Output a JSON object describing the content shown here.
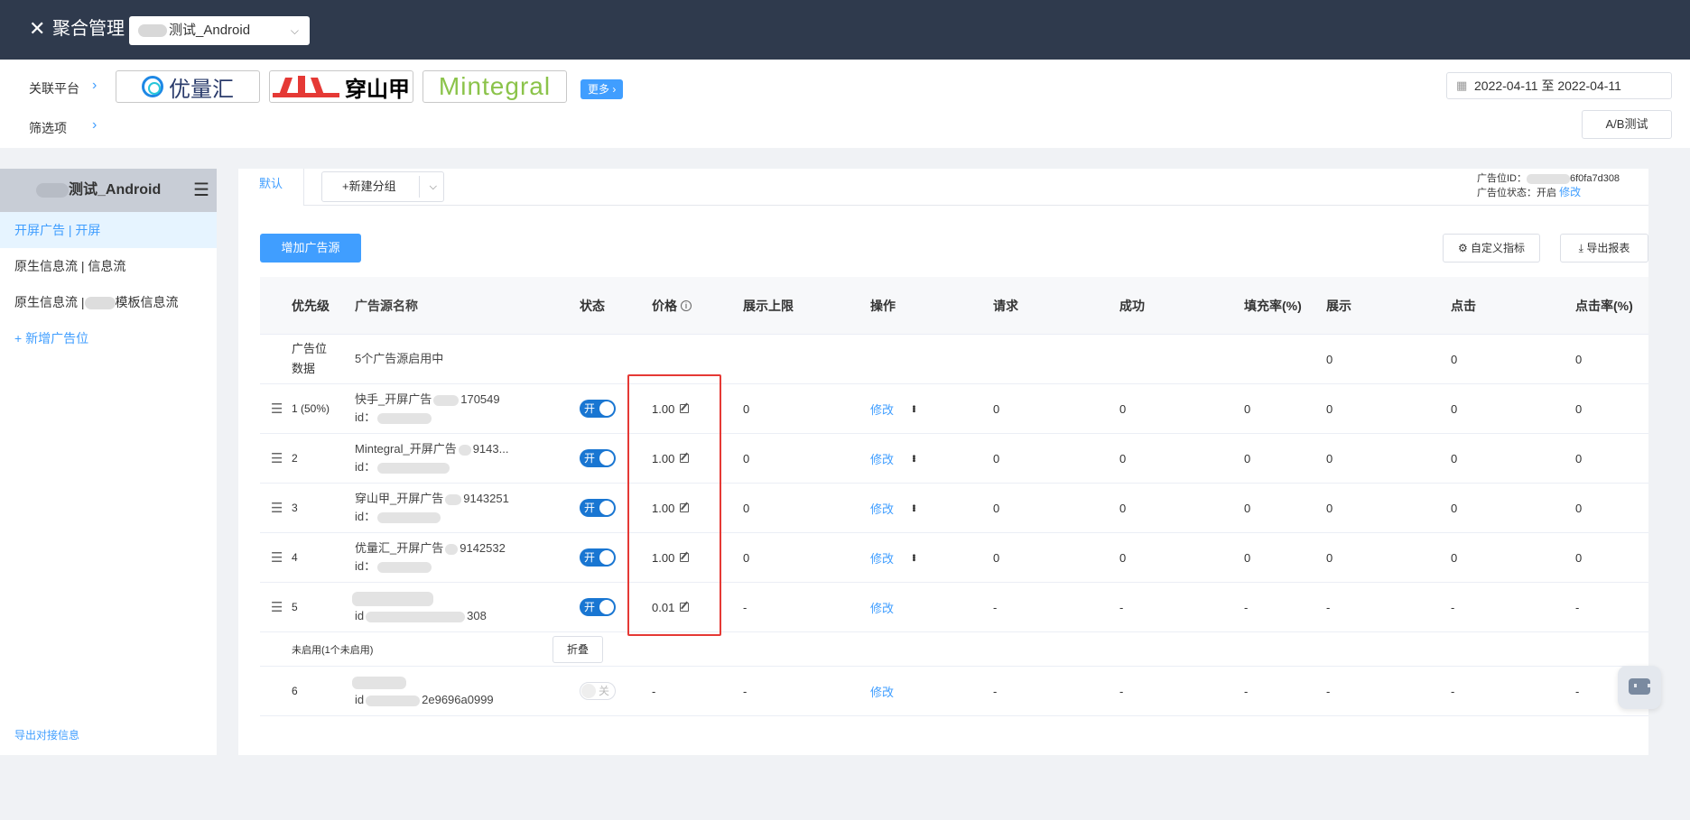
{
  "topbar": {
    "close_icon": "close-icon",
    "title": "聚合管理",
    "app_select_value": "测试_Android"
  },
  "platforms": {
    "label": "关联平台",
    "filter_label": "筛选项",
    "logos": [
      {
        "name": "优量汇",
        "color": "#1e88e5"
      },
      {
        "name": "穿山甲",
        "color": "#e53935"
      },
      {
        "name": "Mintegral",
        "color": "#8bc34a"
      }
    ],
    "more_label": "更多",
    "date_start": "2022-04-11",
    "date_sep": "至",
    "date_end": "2022-04-11",
    "ab_test_label": "A/B测试"
  },
  "sidebar": {
    "app_name": "测试_Android",
    "items": [
      {
        "label": "开屏广告 | 开屏",
        "active": true
      },
      {
        "label": "原生信息流 | 信息流"
      },
      {
        "label_prefix": "原生信息流 |",
        "label_suffix": "模板信息流"
      }
    ],
    "add_label": "+ 新增广告位",
    "export_label": "导出对接信息"
  },
  "main": {
    "tab_default": "默认",
    "new_group_label": "+新建分组",
    "ad_id_label": "广告位ID：",
    "ad_id_suffix": "6f0fa7d308",
    "ad_status_label": "广告位状态：",
    "ad_status_value": "开启",
    "ad_status_edit": "修改",
    "add_source_label": "增加广告源",
    "custom_metrics_label": "自定义指标",
    "export_report_label": "导出报表"
  },
  "table": {
    "headers": {
      "priority": "优先级",
      "name": "广告源名称",
      "status": "状态",
      "price": "价格",
      "cap": "展示上限",
      "op": "操作",
      "req": "请求",
      "succ": "成功",
      "fill": "填充率(%)",
      "show": "展示",
      "click": "点击",
      "ctr": "点击率(%)"
    },
    "summary": {
      "label_line1": "广告位",
      "label_line2": "数据",
      "text": "5个广告源启用中",
      "show": "0",
      "click": "0",
      "ctr": "0"
    },
    "rows": [
      {
        "priority": "1 (50%)",
        "name_prefix": "快手_开屏广告",
        "name_suffix": "170549",
        "id_label": "id：",
        "toggle": "开",
        "price": "1.00",
        "cap": "0",
        "op": "修改",
        "req": "0",
        "succ": "0",
        "fill": "0",
        "show": "0",
        "click": "0",
        "ctr": "0"
      },
      {
        "priority": "2",
        "name_prefix": "Mintegral_开屏广告",
        "name_suffix": "9143...",
        "id_label": "id：",
        "toggle": "开",
        "price": "1.00",
        "cap": "0",
        "op": "修改",
        "req": "0",
        "succ": "0",
        "fill": "0",
        "show": "0",
        "click": "0",
        "ctr": "0"
      },
      {
        "priority": "3",
        "name_prefix": "穿山甲_开屏广告",
        "name_suffix": "9143251",
        "id_label": "id：",
        "toggle": "开",
        "price": "1.00",
        "cap": "0",
        "op": "修改",
        "req": "0",
        "succ": "0",
        "fill": "0",
        "show": "0",
        "click": "0",
        "ctr": "0"
      },
      {
        "priority": "4",
        "name_prefix": "优量汇_开屏广告",
        "name_suffix": "9142532",
        "id_label": "id：",
        "toggle": "开",
        "price": "1.00",
        "cap": "0",
        "op": "修改",
        "req": "0",
        "succ": "0",
        "fill": "0",
        "show": "0",
        "click": "0",
        "ctr": "0"
      },
      {
        "priority": "5",
        "name_prefix": "",
        "name_suffix": "",
        "id_label": "id",
        "id_suffix": "308",
        "toggle": "开",
        "price": "0.01",
        "cap": "-",
        "op": "修改",
        "req": "-",
        "succ": "-",
        "fill": "-",
        "show": "-",
        "click": "-",
        "ctr": "-"
      }
    ],
    "disabled_label": "未启用(1个未启用)",
    "fold_label": "折叠",
    "disabled_rows": [
      {
        "priority": "6",
        "id_label": "id",
        "id_suffix": "2e9696a0999",
        "toggle": "关",
        "price": "-",
        "cap": "-",
        "op": "修改",
        "req": "-",
        "succ": "-",
        "fill": "-",
        "show": "-",
        "click": "-",
        "ctr": "-"
      }
    ]
  },
  "colors": {
    "topbar_bg": "#2f3a4d",
    "accent": "#409eff",
    "toggle_on": "#1976d2",
    "highlight_border": "#e53935"
  }
}
